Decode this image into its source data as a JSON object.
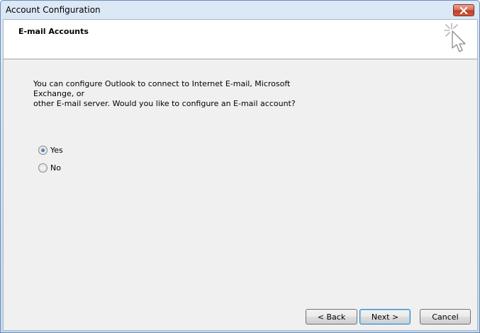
{
  "window": {
    "title": "Account Configuration"
  },
  "header": {
    "title": "E-mail Accounts"
  },
  "main": {
    "description_line1": "You can configure Outlook to connect to Internet E-mail, Microsoft Exchange, or",
    "description_line2": "other E-mail server. Would you like to configure an E-mail account?",
    "options": [
      {
        "label": "Yes",
        "selected": true
      },
      {
        "label": "No",
        "selected": false
      }
    ]
  },
  "footer": {
    "back_label": "< Back",
    "next_label": "Next >",
    "cancel_label": "Cancel"
  },
  "icons": {
    "close": "close-icon",
    "wizard": "wizard-cursor-icon"
  },
  "colors": {
    "close_button": "#c13b22",
    "dialog_background": "#f0f0f0",
    "header_background": "#ffffff",
    "default_button_border": "#3c7fb1"
  }
}
